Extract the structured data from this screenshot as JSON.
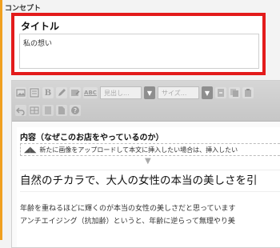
{
  "section_label": "コンセプト",
  "title_box": {
    "heading": "タイトル",
    "value": "私の想い"
  },
  "toolbar": {
    "row1": [
      {
        "icon": "image-insert-icon"
      },
      {
        "icon": "template-icon"
      },
      {
        "icon": "bold-icon",
        "label": "B"
      },
      {
        "icon": "pen-icon"
      },
      {
        "icon": "image-edit-icon"
      },
      {
        "icon": "spellcheck-icon",
        "label": "ABC"
      }
    ],
    "heading_select": "見出し...",
    "size_select": "サイズ...",
    "row1_tail": [
      {
        "icon": "add-row-icon"
      },
      {
        "icon": "copy-icon"
      },
      {
        "icon": "paste-icon"
      }
    ],
    "row2": [
      {
        "icon": "undo-icon"
      },
      {
        "icon": "table-icon"
      },
      {
        "icon": "document-icon"
      },
      {
        "icon": "file-icon"
      },
      {
        "icon": "help-icon"
      }
    ]
  },
  "content": {
    "heading": "内容（なぜこのお店をやっているのか）",
    "upload_hint": "新たに画像をアップロードして本文に挿入したい場合は、挿入したい",
    "headline": "自然のチカラで、大人の女性の本当の美しさを引",
    "paragraph1": "年齢を重ねるほどに輝くのが本当の女性の美しさだと思っています",
    "paragraph2": "アンチエイジング（抗加齢）というと、年齢に逆らって無理やり美"
  }
}
